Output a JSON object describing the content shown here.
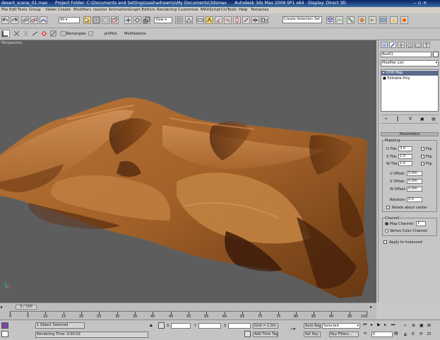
{
  "window": {
    "title": "desert_scene_01.max",
    "project": "Project Folder: C:\\Documents and Settings\\sashadrawn\\s\\My Documents\\3dsmax",
    "app": "Autodesk 3ds Max 2009 SP1 x64",
    "display": "Display: Direct 3D"
  },
  "menu": [
    "File",
    "Edit",
    "Tools",
    "Group",
    "Views",
    "Create",
    "Modifiers",
    "reactor",
    "Animation",
    "Graph Editors",
    "Rendering",
    "Customize",
    "MAXScript",
    "CivTools",
    "Help",
    "Tentacles"
  ],
  "toolbar": {
    "selection_filter": "All",
    "named_selection": "Create Selection Set"
  },
  "toolbar2": {
    "rectangles_label": "Rectangles",
    "pinpick_label": "pinPick",
    "multiselect_label": "MultiSelecto"
  },
  "viewport": {
    "label": "Perspective"
  },
  "command_panel": {
    "object_name": "Box01",
    "modifier_list": "Modifier List",
    "stack": [
      "UVW Map",
      "Editable Poly"
    ],
    "rollout_title": "Parameters",
    "mapping_label": "Mapping",
    "u_tile_label": "U Tile:",
    "u_tile": "3.0",
    "u_flip": "Flip",
    "v_tile_label": "V Tile:",
    "v_tile": "1.0",
    "v_flip": "Flip",
    "w_tile_label": "W Tile:",
    "w_tile": "1.0",
    "w_flip": "Flip",
    "u_offset_label": "U Offset:",
    "u_offset": "0.0m",
    "v_offset_label": "V Offset:",
    "v_offset": "0.0m",
    "w_offset_label": "W Offset:",
    "w_offset": "0.0m",
    "rotation_label": "Rotation:",
    "rotation": "0.0",
    "rotate_about_center": "Rotate about center",
    "channel_label": "Channel",
    "map_channel_label": "Map Channel:",
    "map_channel": "1",
    "vertex_color_channel": "Vertex Color Channel",
    "apply_to_instanced": "Apply to Instanced"
  },
  "timeline": {
    "frame_counter": "0 / 100",
    "ticks": [
      "0",
      "5",
      "10",
      "15",
      "20",
      "25",
      "30",
      "35",
      "40",
      "45",
      "50",
      "55",
      "60",
      "65",
      "70",
      "75",
      "80",
      "85",
      "90",
      "95",
      "100"
    ]
  },
  "status": {
    "selection": "1 Object Selected",
    "render_time": "Rendering Time: 0:00:02",
    "x_label": "X",
    "y_label": "Y",
    "z_label": "Z",
    "grid": "Grid = 1.0m",
    "add_time_tag": "Add Time Tag",
    "auto_key": "Auto Key",
    "auto_key_filter": "Selected",
    "set_key": "Set Key",
    "key_filters": "Key Filters...",
    "current_frame": "0"
  }
}
